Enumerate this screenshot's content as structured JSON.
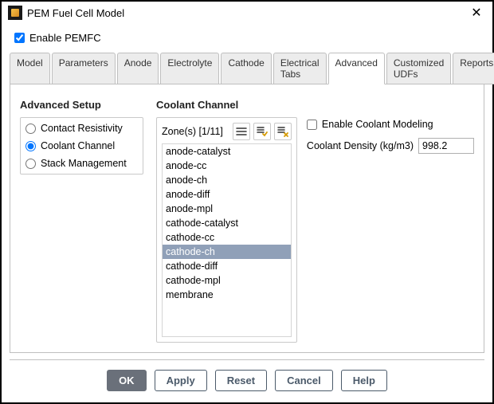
{
  "window": {
    "title": "PEM Fuel Cell Model",
    "close_glyph": "✕"
  },
  "enable": {
    "label": "Enable PEMFC",
    "checked": true
  },
  "tabs": [
    {
      "label": "Model",
      "active": false
    },
    {
      "label": "Parameters",
      "active": false
    },
    {
      "label": "Anode",
      "active": false
    },
    {
      "label": "Electrolyte",
      "active": false
    },
    {
      "label": "Cathode",
      "active": false
    },
    {
      "label": "Electrical Tabs",
      "active": false
    },
    {
      "label": "Advanced",
      "active": true
    },
    {
      "label": "Customized UDFs",
      "active": false
    },
    {
      "label": "Reports",
      "active": false
    }
  ],
  "advanced": {
    "sidebar_title": "Advanced Setup",
    "options": [
      {
        "label": "Contact Resistivity",
        "selected": false
      },
      {
        "label": "Coolant Channel",
        "selected": true
      },
      {
        "label": "Stack Management",
        "selected": false
      }
    ],
    "panel_title": "Coolant Channel",
    "zones_label": "Zone(s) [1/11]",
    "icons": {
      "filter": "≡",
      "select_all": "≡✓",
      "deselect_all": "≡✕"
    },
    "zones": [
      {
        "name": "anode-catalyst",
        "selected": false
      },
      {
        "name": "anode-cc",
        "selected": false
      },
      {
        "name": "anode-ch",
        "selected": false
      },
      {
        "name": "anode-diff",
        "selected": false
      },
      {
        "name": "anode-mpl",
        "selected": false
      },
      {
        "name": "cathode-catalyst",
        "selected": false
      },
      {
        "name": "cathode-cc",
        "selected": false
      },
      {
        "name": "cathode-ch",
        "selected": true
      },
      {
        "name": "cathode-diff",
        "selected": false
      },
      {
        "name": "cathode-mpl",
        "selected": false
      },
      {
        "name": "membrane",
        "selected": false
      }
    ],
    "enable_coolant": {
      "label": "Enable Coolant Modeling",
      "checked": false
    },
    "density": {
      "label": "Coolant Density (kg/m3)",
      "value": "998.2"
    }
  },
  "footer": {
    "ok": "OK",
    "apply": "Apply",
    "reset": "Reset",
    "cancel": "Cancel",
    "help": "Help"
  }
}
